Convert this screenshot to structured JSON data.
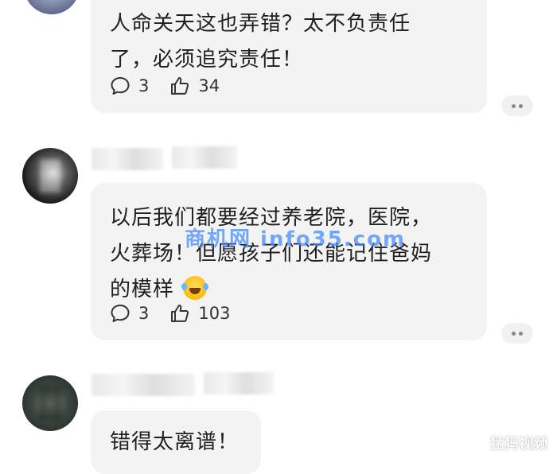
{
  "comments": [
    {
      "text_lines": [
        "人命关天这也弄错？太不负责任",
        "了，必须追究责任！"
      ],
      "reply_count": "3",
      "like_count": "34"
    },
    {
      "text_lines": [
        "以后我们都要经过养老院，医院，",
        "火葬场！但愿孩子们还能记住爸妈",
        "的模样"
      ],
      "reply_count": "3",
      "like_count": "103"
    },
    {
      "text_lines": [
        "错得太离谱！"
      ]
    }
  ],
  "watermark": "商机网 info35.com",
  "logo_watermark": "猛犸视频",
  "icons": {
    "reply": "comment-icon",
    "like": "thumbs-up-icon",
    "more": "more-icon",
    "emoji": "laughing-crying-emoji"
  }
}
